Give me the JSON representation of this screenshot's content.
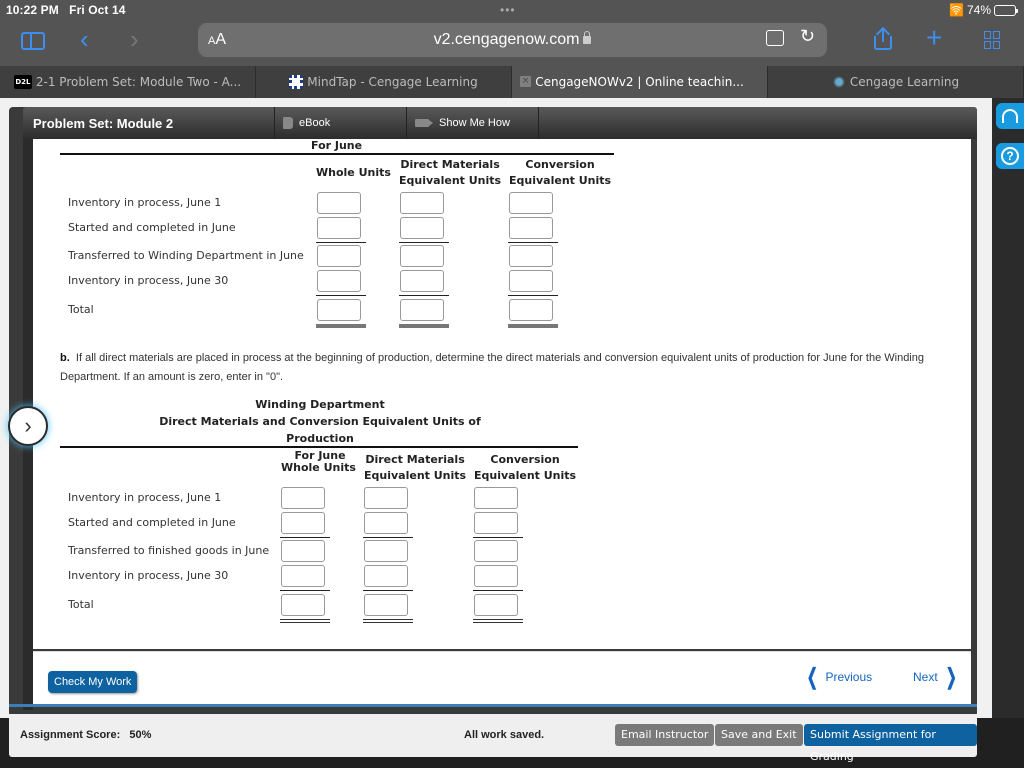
{
  "status_bar": {
    "time": "10:22 PM",
    "date": "Fri Oct 14",
    "battery_text": "74%",
    "battery_level": 0.74
  },
  "browser": {
    "text_size_label": "AA",
    "url": "v2.cengagenow.com",
    "icons": [
      "sidebar-icon",
      "back-icon",
      "forward-icon",
      "lock-icon",
      "extension-icon",
      "reload-icon",
      "share-icon",
      "new-tab-icon",
      "tabs-overview-icon"
    ]
  },
  "tabs": [
    {
      "label": "2-1 Problem Set: Module Two - A...",
      "favicon": "D2L",
      "active": false
    },
    {
      "label": "MindTap - Cengage Learning",
      "favicon": "mindtap",
      "active": false
    },
    {
      "label": "CengageNOWv2 | Online teachin...",
      "favicon": "close",
      "active": true
    },
    {
      "label": "Cengage Learning",
      "favicon": "cengage",
      "active": false
    }
  ],
  "header": {
    "title": "Problem Set: Module 2",
    "ebook_label": "eBook",
    "show_me_how_label": "Show Me How"
  },
  "table_a": {
    "subtitle": "For June",
    "columns": {
      "whole": "Whole Units",
      "dm_line1": "Direct Materials",
      "dm_line2": "Equivalent Units",
      "conv_line1": "Conversion",
      "conv_line2": "Equivalent Units"
    },
    "rows": [
      "Inventory in process, June 1",
      "Started and completed in June",
      "Transferred to Winding Department in June",
      "Inventory in process, June 30",
      "Total"
    ]
  },
  "part_b": {
    "letter": "b.",
    "text": "If all direct materials are placed in process at the beginning of production, determine the direct materials and conversion equivalent units of production for June for the Winding Department. If an amount is zero, enter in \"0\"."
  },
  "table_b": {
    "title1": "Winding Department",
    "title2": "Direct Materials and Conversion Equivalent Units of Production",
    "subtitle": "For June",
    "columns": {
      "whole": "Whole Units",
      "dm_line1": "Direct Materials",
      "dm_line2": "Equivalent Units",
      "conv_line1": "Conversion",
      "conv_line2": "Equivalent Units"
    },
    "rows": [
      "Inventory in process, June 1",
      "Started and completed in June",
      "Transferred to finished goods in June",
      "Inventory in process, June 30",
      "Total"
    ]
  },
  "nav": {
    "check_label": "Check My Work",
    "previous_label": "Previous",
    "next_label": "Next"
  },
  "footer": {
    "score_label": "Assignment Score:",
    "score_value": "50%",
    "saved_text": "All work saved.",
    "email_label": "Email Instructor",
    "save_exit_label": "Save and Exit",
    "submit_label": "Submit Assignment for Grading"
  },
  "colors": {
    "accent": "#0f62a0",
    "link": "#1565c0",
    "support": "#1a9be0"
  }
}
